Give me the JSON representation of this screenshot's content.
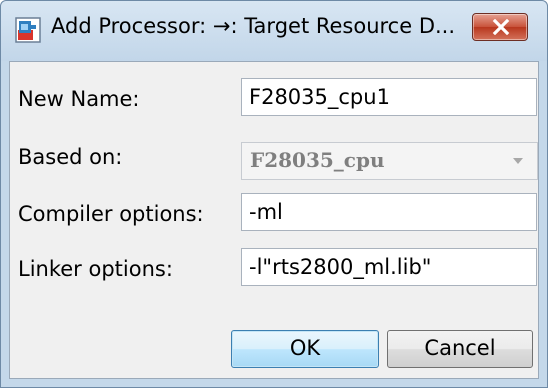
{
  "window": {
    "title": "Add Processor: →: Target Resource D...",
    "icon": "processor-app-icon",
    "close_icon": "close-x-icon"
  },
  "form": {
    "new_name": {
      "label": "New Name:",
      "value": "F28035_cpu1"
    },
    "based_on": {
      "label": "Based on:",
      "value": "F28035_cpu",
      "enabled": false
    },
    "compiler_options": {
      "label": "Compiler options:",
      "value": "-ml"
    },
    "linker_options": {
      "label": "Linker options:",
      "value": "-l\"rts2800_ml.lib\""
    }
  },
  "buttons": {
    "ok": "OK",
    "cancel": "Cancel"
  },
  "colors": {
    "titlebar": "#c4d8ea",
    "client_bg": "#f0f0f0",
    "close_button": "#c8523a",
    "ok_button_border": "#3c7fb1",
    "disabled_text": "#7f7f7f"
  }
}
